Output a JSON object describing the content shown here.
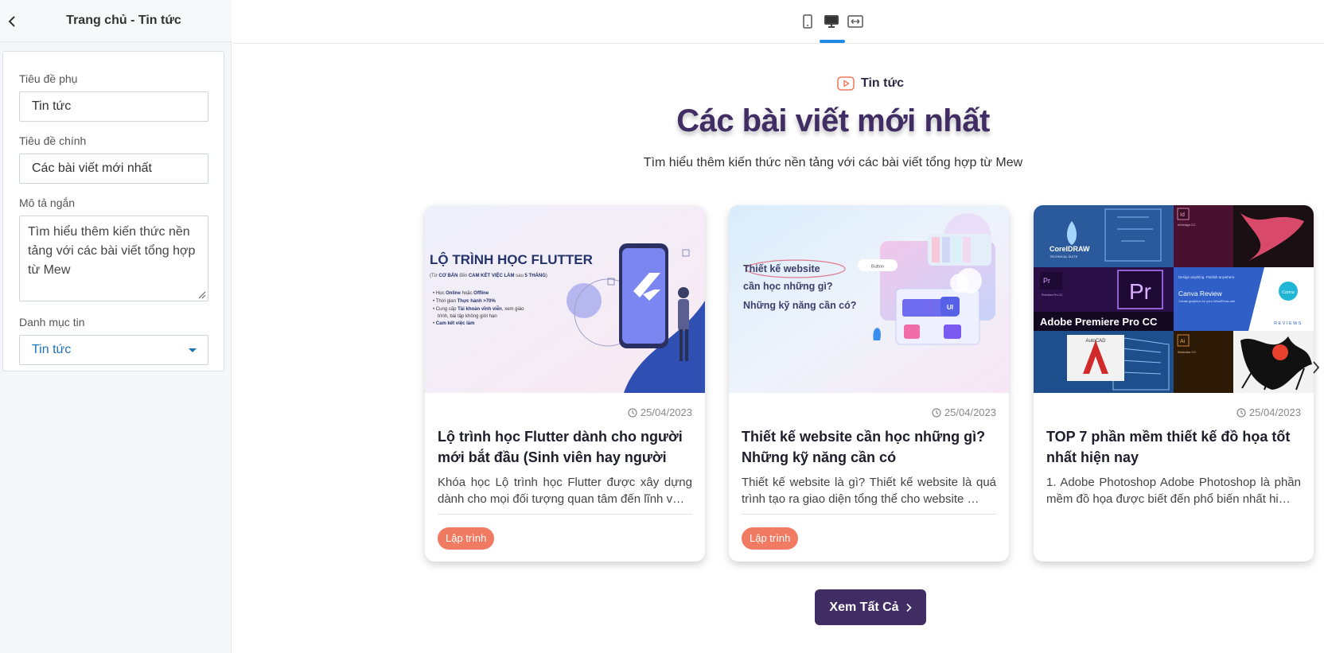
{
  "sidebar": {
    "title": "Trang chủ - Tin tức",
    "fields": {
      "subtitle_label": "Tiêu đề phụ",
      "subtitle_value": "Tin tức",
      "main_title_label": "Tiêu đề chính",
      "main_title_value": "Các bài viết mới nhất",
      "short_desc_label": "Mô tả ngắn",
      "short_desc_value": "Tìm hiểu thêm kiến thức nền tảng với các bài viết tổng hợp từ Mew",
      "category_label": "Danh mục tin",
      "category_value": "Tin tức"
    }
  },
  "topbar": {
    "devices": [
      "mobile-icon",
      "desktop-icon",
      "fullwidth-icon"
    ],
    "active_device": "desktop"
  },
  "section": {
    "subtitle": "Tin tức",
    "title": "Các bài viết mới nhất",
    "description": "Tìm hiểu thêm kiến thức nền tảng với các bài viết tổng hợp từ Mew",
    "view_all_label": "Xem Tất Cả"
  },
  "cards": [
    {
      "date": "25/04/2023",
      "title": "Lộ trình học Flutter dành cho người mới bắt đầu (Sinh viên hay người trái…",
      "excerpt": "Khóa học Lộ trình học Flutter được xây dựng dành cho mọi đối tượng quan tâm đến lĩnh v…",
      "tag": "Lập trình",
      "image": {
        "heading": "LỘ TRÌNH HỌC FLUTTER",
        "sub_prefix": "(Từ ",
        "sub_bold1": "CƠ BẢN",
        "sub_mid": " đến ",
        "sub_bold2": "CAM KẾT VIỆC LÀM",
        "sub_suffix": " sau ",
        "sub_bold3": "5 THÁNG",
        "sub_end": ")",
        "b1_prefix": "Học ",
        "b1_bold1": "Online",
        "b1_mid": " hoặc ",
        "b1_bold2": "Offline",
        "b2_prefix": "Thời gian ",
        "b2_bold": "Thực hành >70%",
        "b3_prefix": "Cung cấp ",
        "b3_bold": "Tài khoản vĩnh viễn",
        "b3_rest": ", xem giáo",
        "b3_line2": "trình, bài tập không giới hạn",
        "b4_bold": "Cam kết việc làm"
      }
    },
    {
      "date": "25/04/2023",
      "title": "Thiết kế website cần học những gì? Những kỹ năng cần có",
      "excerpt": "  Thiết kế website là gì? Thiết kế website là quá trình tạo ra giao diện tổng thể cho website …",
      "tag": "Lập trình",
      "image": {
        "line1": "Thiết kế website",
        "line2": "cần học những gì?",
        "line3": "Những kỹ năng cần có?",
        "button": "Button",
        "ui_badge": "UI"
      }
    },
    {
      "date": "25/04/2023",
      "title": "TOP 7 phần mềm thiết kế đồ họa tốt nhất hiện nay",
      "excerpt": "1. Adobe Photoshop Adobe Photoshop là phần mềm đồ họa được biết đến phổ biến nhất hi…",
      "tag": "",
      "image": {
        "corel": "CorelDRAW",
        "corel_sub": "TECHNICAL SUITE",
        "indesign": "InDesign CC",
        "id_logo": "Id",
        "pr_small": "Pr",
        "premiere_small": "Premiere Pro CC",
        "pr_logo": "Pr",
        "canva_title": "Canva Review",
        "canva_sub": "Create graphics for your WordPress site",
        "canva_top": "Design anything. Publish anywhere.",
        "canva_logo": "Canva",
        "reviews": "REVIEWS",
        "premiere_label": "Adobe Premiere Pro CC",
        "autocad": "AutoCAD",
        "ai_logo": "Ai",
        "illustrator": "Illustrator CC"
      }
    }
  ],
  "colors": {
    "title": "#3f2d63",
    "button": "#3f2d63",
    "tag": "#f07b62",
    "accent": "#1e88e5",
    "select_text": "#1f73b7"
  }
}
